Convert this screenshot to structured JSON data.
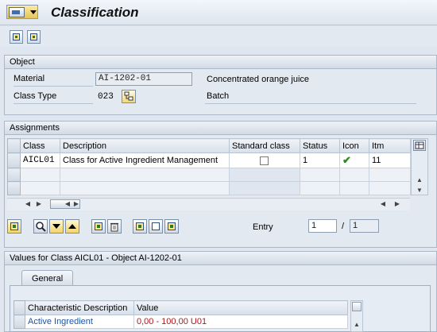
{
  "window": {
    "title": "Classification"
  },
  "object_section": {
    "header": "Object",
    "material_label": "Material",
    "material_value": "AI-1202-01",
    "material_description": "Concentrated orange juice",
    "class_type_label": "Class Type",
    "class_type_value": "023",
    "class_type_description": "Batch"
  },
  "assignments": {
    "header": "Assignments",
    "columns": [
      "Class",
      "Description",
      "Standard class",
      "Status",
      "Icon",
      "Itm"
    ],
    "rows": [
      {
        "class": "AICL01",
        "description": "Class for Active Ingredient Management",
        "standard_class": false,
        "status": "1",
        "icon": "checkmark-icon",
        "item": "11"
      }
    ],
    "entry_label": "Entry",
    "entry_value": "1",
    "entry_separator": "/",
    "entry_total": "1"
  },
  "values_section": {
    "header": "Values for Class AICL01 - Object AI-1202-01",
    "tabs": [
      "General"
    ],
    "columns": [
      "Characteristic Description",
      "Value"
    ],
    "rows": [
      {
        "characteristic": "Active Ingredient",
        "value": "0,00 - 100,00 U01"
      }
    ]
  },
  "colors": {
    "background": "#dfe6ef",
    "characteristic_link": "#1d56a6",
    "value_text": "#b3141a",
    "checkmark": "#2d8a1f"
  }
}
